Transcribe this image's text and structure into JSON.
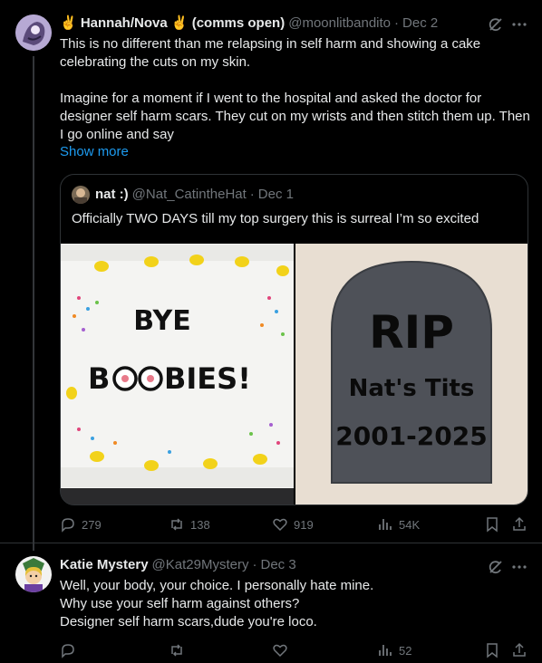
{
  "tweets": [
    {
      "author": {
        "name": "✌️ Hannah/Nova ✌️ (comms open)",
        "handle": "@moonlitbandito",
        "date": "Dec 2"
      },
      "text": [
        "This is no different than me relapsing in self harm and showing a cake celebrating the cuts on my skin.",
        "Imagine for a moment if I went to the hospital and asked the doctor for designer self harm scars. They cut on my wrists and then stitch them up. Then I go online and say"
      ],
      "show_more": "Show more",
      "quote": {
        "author": {
          "name": "nat :)",
          "handle": "@Nat_CatintheHat",
          "date": "Dec 1"
        },
        "text": "Officially TWO DAYS till my top surgery this is surreal I’m so excited",
        "media": {
          "cake_text_line1": "BYE",
          "cake_text_line2_a": "B",
          "cake_text_line2_b": "BIES!",
          "tomb_line1": "RIP",
          "tomb_line2": "Nat's Tits",
          "tomb_line3": "2001-2025"
        }
      },
      "stats": {
        "replies": "279",
        "reposts": "138",
        "likes": "919",
        "views": "54K"
      }
    },
    {
      "author": {
        "name": "Katie Mystery",
        "handle": "@Kat29Mystery",
        "date": "Dec 3"
      },
      "text": [
        "Well, your body, your choice. I personally hate mine.",
        "Why use your self harm against others?",
        "Designer self harm scars,dude you're loco."
      ],
      "stats": {
        "replies": "",
        "reposts": "",
        "likes": "",
        "views": "52"
      }
    }
  ],
  "separator": "·"
}
